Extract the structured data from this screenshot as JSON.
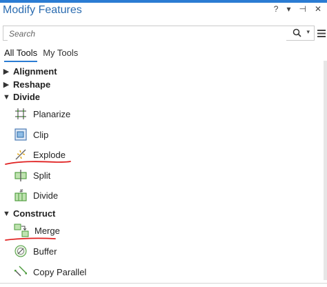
{
  "window": {
    "title": "Modify Features",
    "help_glyph": "?",
    "options_glyph": "▾",
    "pin_glyph": "⊣",
    "close_glyph": "✕"
  },
  "search": {
    "placeholder": "Search",
    "value": ""
  },
  "tabs": [
    {
      "label": "All Tools",
      "active": true
    },
    {
      "label": "My Tools",
      "active": false
    }
  ],
  "categories": {
    "alignment": {
      "label": "Alignment",
      "expanded": false
    },
    "reshape": {
      "label": "Reshape",
      "expanded": false
    },
    "divide": {
      "label": "Divide",
      "expanded": true,
      "tools": [
        {
          "label": "Planarize"
        },
        {
          "label": "Clip"
        },
        {
          "label": "Explode"
        },
        {
          "label": "Split"
        },
        {
          "label": "Divide"
        }
      ]
    },
    "construct": {
      "label": "Construct",
      "expanded": true,
      "tools": [
        {
          "label": "Merge"
        },
        {
          "label": "Buffer"
        },
        {
          "label": "Copy Parallel"
        }
      ]
    }
  },
  "colors": {
    "accent": "#2b7cd3",
    "annotation_red": "#e02020",
    "title_blue": "#2b6cb0"
  }
}
